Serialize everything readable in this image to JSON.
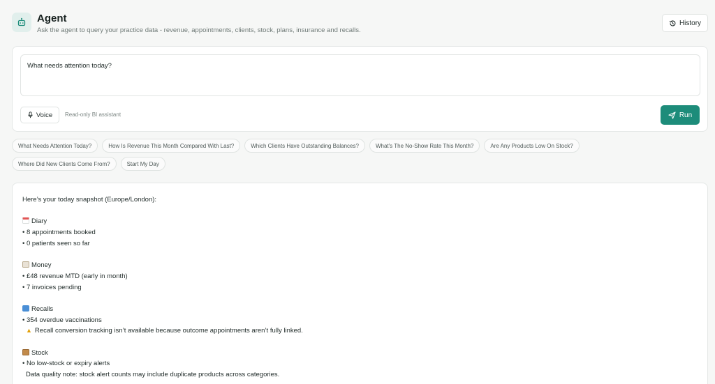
{
  "header": {
    "title": "Agent",
    "subtitle": "Ask the agent to query your practice data - revenue, appointments, clients, stock, plans, insurance and recalls.",
    "history_label": "History",
    "icons": {
      "app": "robot-icon",
      "history": "history-icon"
    }
  },
  "query": {
    "value": "What needs attention today?",
    "voice_label": "Voice",
    "readonly_label": "Read-only BI assistant",
    "run_label": "Run",
    "accent_color": "#1d8c7a"
  },
  "suggestions": [
    "What Needs Attention Today?",
    "How Is Revenue This Month Compared With Last?",
    "Which Clients Have Outstanding Balances?",
    "What's The No-Show Rate This Month?",
    "Are Any Products Low On Stock?",
    "Where Did New Clients Come From?",
    "Start My Day"
  ],
  "result": {
    "intro": "Here’s your today snapshot (Europe/London):",
    "diary": {
      "heading": "Diary",
      "lines": [
        "• 8 appointments booked",
        "• 0 patients seen so far"
      ]
    },
    "money": {
      "heading": "Money",
      "lines": [
        "• £48 revenue MTD (early in month)",
        "• 7 invoices pending"
      ]
    },
    "recalls": {
      "heading": "Recalls",
      "lines": [
        "• 354 overdue vaccinations"
      ],
      "warning": "Recall conversion tracking isn’t available because outcome appointments aren’t fully linked."
    },
    "stock": {
      "heading": "Stock",
      "lines": [
        "• No low-stock or expiry alerts"
      ],
      "note": "Data quality note: stock alert counts may include duplicate products across categories."
    }
  }
}
